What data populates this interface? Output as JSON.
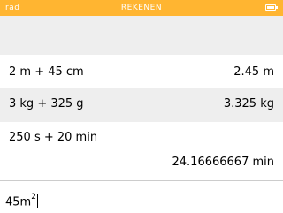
{
  "status_bar": {
    "angle_mode": "rad",
    "title": "REKENEN",
    "battery_icon": "battery-icon",
    "color": "#ffb531"
  },
  "history": [
    {
      "expression": "2 m + 45 cm",
      "result": "2.45 m"
    },
    {
      "expression": "3 kg + 325 g",
      "result": "3.325 kg"
    },
    {
      "expression": "250 s + 20 min",
      "result": "24.16666667 min"
    }
  ],
  "input": {
    "value": "45m",
    "exponent": "2"
  }
}
